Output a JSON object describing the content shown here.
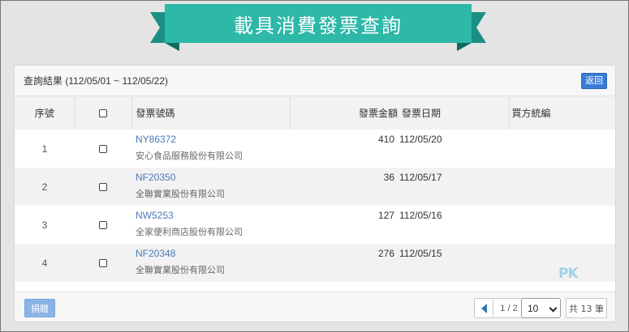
{
  "banner": {
    "title": "載具消費發票查詢"
  },
  "panel": {
    "title": "查詢結果 (112/05/01 ~ 112/05/22)",
    "back_label": "返回"
  },
  "table": {
    "headers": {
      "no": "序號",
      "invoice_no": "發票號碼",
      "amount": "發票金額",
      "date": "發票日期",
      "buyer_id": "買方統編"
    },
    "rows": [
      {
        "no": "1",
        "invoice_no": "NY86372",
        "seller": "安心食品服務股份有限公司",
        "amount": "410",
        "date": "112/05/20",
        "buyer_id": ""
      },
      {
        "no": "2",
        "invoice_no": "NF20350",
        "seller": "全聯實業股份有限公司",
        "amount": "36",
        "date": "112/05/17",
        "buyer_id": ""
      },
      {
        "no": "3",
        "invoice_no": "NW5253",
        "seller": "全家便利商店股份有限公司",
        "amount": "127",
        "date": "112/05/16",
        "buyer_id": ""
      },
      {
        "no": "4",
        "invoice_no": "NF20348",
        "seller": "全聯實業股份有限公司",
        "amount": "276",
        "date": "112/05/15",
        "buyer_id": ""
      }
    ]
  },
  "footer": {
    "donate_label": "捐贈",
    "page_label": "1 / 2",
    "page_size": "10",
    "total_label": "共 13 筆"
  },
  "watermark": {
    "text": "PK"
  },
  "colors": {
    "ribbon": "#2db8a8",
    "ribbon_dark": "#1a8f82",
    "link": "#4a7ab8",
    "primary_button": "#3a7bd5"
  }
}
